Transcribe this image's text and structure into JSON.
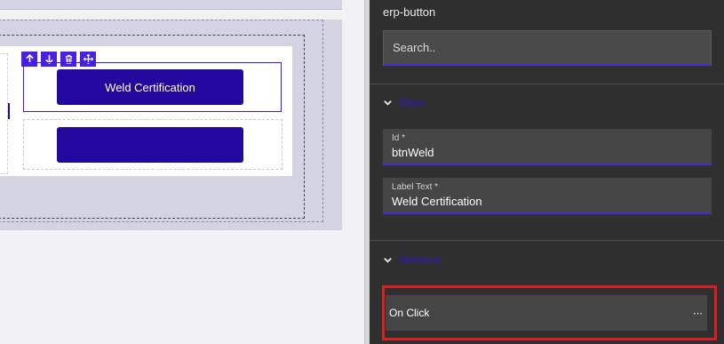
{
  "canvas": {
    "buttons": [
      {
        "label": "Weld Certification"
      },
      {
        "label": ""
      }
    ],
    "toolbar": {
      "move_up_icon": "arrow-up",
      "move_down_icon": "arrow-down",
      "delete_icon": "trash",
      "drag_icon": "move-arrows"
    }
  },
  "properties": {
    "component_name": "erp-button",
    "search": {
      "placeholder": "Search..",
      "value": ""
    },
    "sections": {
      "basic": {
        "label": "Basic"
      },
      "behavior": {
        "label": "Behavior"
      }
    },
    "fields": {
      "id": {
        "label": "Id *",
        "value": "btnWeld"
      },
      "label_text": {
        "label": "Label Text *",
        "value": "Weld Certification"
      }
    },
    "on_click": {
      "label": "On Click",
      "more": "⋯"
    }
  },
  "colors": {
    "accent": "#4a2ad8",
    "button_bg": "#22089e",
    "panel_bg": "#2f2f2f",
    "highlight": "#d81e1e"
  }
}
